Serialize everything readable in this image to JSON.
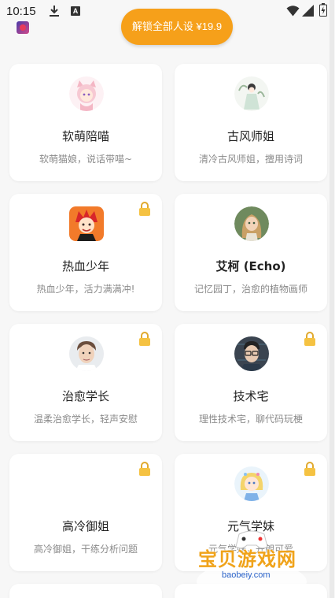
{
  "status_bar": {
    "time": "10:15",
    "a_icon_label": "A"
  },
  "unlock_button_label": "解锁全部人设 ¥19.9",
  "colors": {
    "accent": "#f6a01a",
    "lock": "#f5c242",
    "card": "#ffffff",
    "background": "#f7f7f7"
  },
  "cards": [
    {
      "name": "软萌陪喵",
      "desc": "软萌猫娘，说话带喵~",
      "locked": false,
      "avatar": "cat-girl-avatar-icon"
    },
    {
      "name": "古风师姐",
      "desc": "清冷古风师姐，擅用诗词",
      "locked": false,
      "avatar": "ancient-style-girl-avatar-icon"
    },
    {
      "name": "热血少年",
      "desc": "热血少年，活力满满冲!",
      "locked": true,
      "avatar": "hot-blooded-boy-avatar-icon"
    },
    {
      "name": "艾柯 (Echo)",
      "desc": "记忆园丁，治愈的植物画师",
      "locked": false,
      "avatar": "echo-avatar-icon"
    },
    {
      "name": "治愈学长",
      "desc": "温柔治愈学长，轻声安慰",
      "locked": true,
      "avatar": "senior-boy-avatar-icon"
    },
    {
      "name": "技术宅",
      "desc": "理性技术宅，聊代码玩梗",
      "locked": true,
      "avatar": "tech-geek-avatar-icon"
    },
    {
      "name": "高冷御姐",
      "desc": "高冷御姐，干练分析问题",
      "locked": true,
      "avatar": "none"
    },
    {
      "name": "元气学妹",
      "desc": "元气学妹，开朗可爱",
      "locked": true,
      "avatar": "cheerful-girl-avatar-icon"
    }
  ],
  "watermark": {
    "text": "宝贝游戏网",
    "url": "baobeiy.com"
  }
}
